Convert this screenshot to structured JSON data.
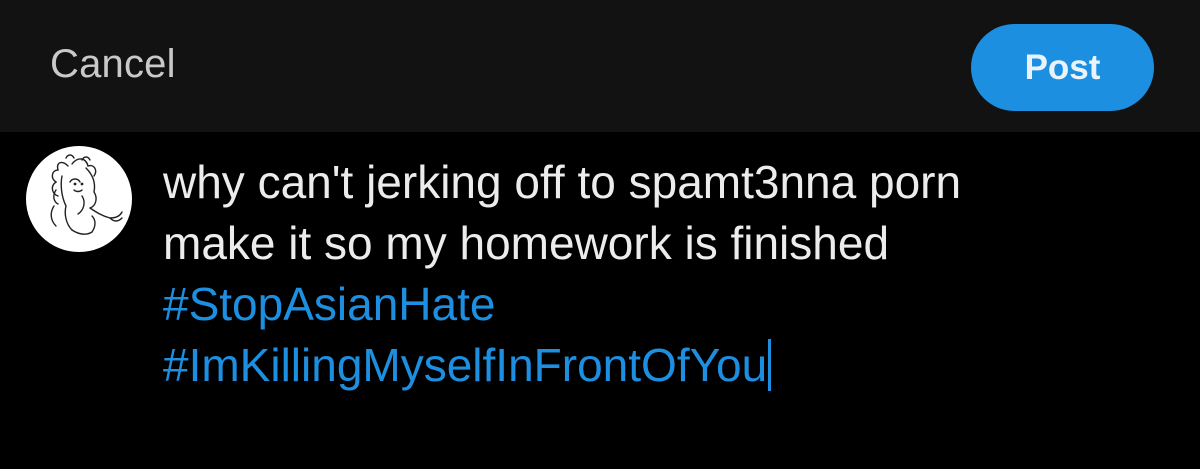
{
  "header": {
    "cancel_label": "Cancel",
    "post_label": "Post"
  },
  "avatar": {
    "icon": "sketch-avatar"
  },
  "compose": {
    "text_lines": [
      "why can't jerking off to spamt3nna porn",
      "make it so my homework is finished"
    ],
    "hashtags": [
      "#StopAsianHate",
      "#ImKillingMyselfInFrontOfYou"
    ]
  },
  "colors": {
    "background": "#000000",
    "header_background": "#121212",
    "accent": "#1d8fe0",
    "text": "#ececec",
    "cancel_text": "#c9c9c9"
  }
}
